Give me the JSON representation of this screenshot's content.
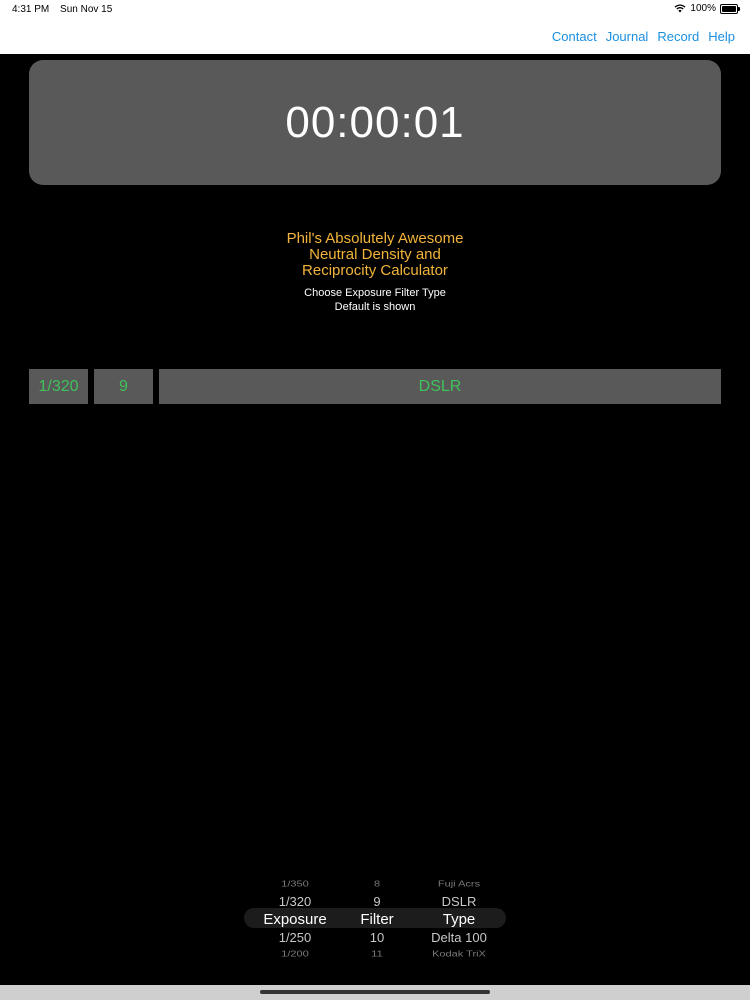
{
  "status": {
    "time": "4:31 PM",
    "date": "Sun Nov 15",
    "battery": "100%"
  },
  "nav": {
    "contact": "Contact",
    "journal": "Journal",
    "record": "Record",
    "help": "Help"
  },
  "timer": {
    "value": "00:00:01"
  },
  "title": {
    "line1": "Phil's Absolutely Awesome",
    "line2": "Neutral Density and",
    "line3": "Reciprocity Calculator"
  },
  "subtitle": {
    "line1": "Choose Exposure Filter Type",
    "line2": "Default is shown"
  },
  "selection": {
    "exposure": "1/320",
    "filter": "9",
    "type": "DSLR"
  },
  "picker": {
    "exposure": [
      "1/350",
      "1/320",
      "Exposure",
      "1/250",
      "1/200"
    ],
    "filter": [
      "8",
      "9",
      "Filter",
      "10",
      "11"
    ],
    "type": [
      "Fuji Acrs",
      "DSLR",
      "Type",
      "Delta 100",
      "Kodak TriX"
    ]
  },
  "colors": {
    "accent": "#1a8fe0",
    "title": "#f2b43a",
    "value": "#3fc35a",
    "panel": "#595959"
  }
}
